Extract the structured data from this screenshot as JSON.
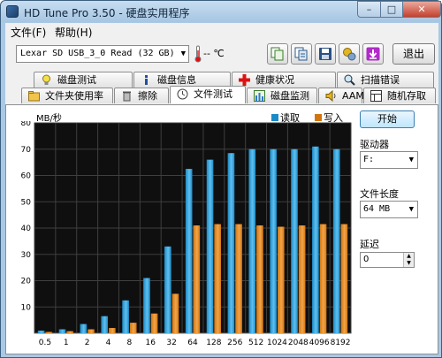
{
  "window": {
    "title": "HD Tune Pro 3.50 - 硬盘实用程序",
    "min": "–",
    "max": "□",
    "close": "✕"
  },
  "menu": {
    "file": "文件(F)",
    "help": "帮助(H)"
  },
  "toolbar": {
    "drive": "Lexar   SD  USB_3_0 Read (32 GB)",
    "temperature": "-- ℃",
    "exit_label": "退出",
    "icons": [
      "copy-icon",
      "copy-text-icon",
      "save-icon",
      "options-icon",
      "download-icon"
    ]
  },
  "tabs": {
    "row1": [
      "磁盘测试",
      "磁盘信息",
      "健康状况",
      "扫描错误"
    ],
    "row2": [
      "文件夹使用率",
      "擦除",
      "文件测试",
      "磁盘监测",
      "AAM",
      "随机存取"
    ],
    "active": "文件测试"
  },
  "panel": {
    "start_label": "开始",
    "drive_label": "驱动器",
    "drive_value": "F:",
    "file_length_label": "文件长度",
    "file_length_value": "64 MB",
    "delay_label": "延迟",
    "delay_value": "0"
  },
  "colors": {
    "read": "#1c8ac6",
    "write": "#d2750f",
    "chart_bg": "#0f0f0f",
    "grid": "#3f3f3f"
  },
  "chart_data": {
    "type": "bar",
    "ylabel": "MB/秒",
    "ylim": [
      0,
      80
    ],
    "yticks": [
      10,
      20,
      30,
      40,
      50,
      60,
      70,
      80
    ],
    "categories": [
      "0.5",
      "1",
      "2",
      "4",
      "8",
      "16",
      "32",
      "64",
      "128",
      "256",
      "512",
      "1024",
      "2048",
      "4096",
      "8192"
    ],
    "series": [
      {
        "name": "读取",
        "values": [
          1,
          1.5,
          3.5,
          6.5,
          12.5,
          21,
          33,
          62.5,
          66,
          68.5,
          70,
          70,
          70,
          71,
          70
        ]
      },
      {
        "name": "写入",
        "values": [
          0.5,
          0.8,
          1.5,
          2,
          4,
          7.5,
          15,
          41,
          41.5,
          41.5,
          41,
          40.5,
          41,
          41.5,
          41.5
        ]
      }
    ],
    "legend": "top-right",
    "grid": true
  }
}
